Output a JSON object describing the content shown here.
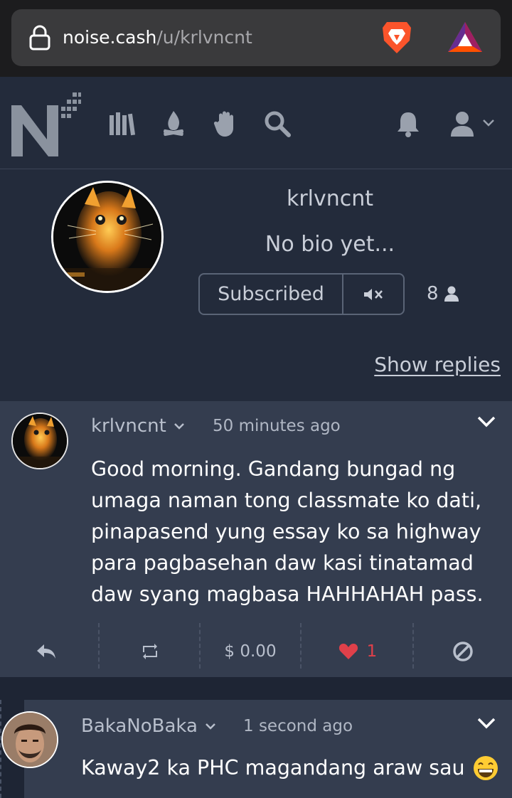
{
  "browser": {
    "url_host": "noise.cash",
    "url_path": "/u/krlvncnt",
    "icons": [
      "lock-icon",
      "brave-icon",
      "bat-icon"
    ]
  },
  "nav": {
    "icons": [
      "noise-logo",
      "library-icon",
      "campfire-icon",
      "hand-icon",
      "search-icon",
      "bell-icon",
      "user-icon",
      "chevron-down-icon"
    ]
  },
  "profile": {
    "username": "krlvncnt",
    "bio": "No bio yet...",
    "subscribe_label": "Subscribed",
    "subscriber_count": "8",
    "show_replies_label": "Show replies"
  },
  "post": {
    "author": "krlvncnt",
    "time": "50 minutes ago",
    "text": "Good morning. Gandang bungad ng umaga naman tong classmate ko dati, pinapasend yung essay ko sa highway para pagbasehan daw kasi tinatamad daw syang magbasa HAHHAHAH pass.",
    "tip_amount": "$ 0.00",
    "likes": "1"
  },
  "reply": {
    "author": "BakaNoBaka",
    "time": "1 second ago",
    "text": "Kaway2 ka PHC magandang araw sau"
  },
  "colors": {
    "page_bg": "#1b2130",
    "header_bg": "#232b3b",
    "card_bg": "#343d4f",
    "like_red": "#e0404a"
  }
}
